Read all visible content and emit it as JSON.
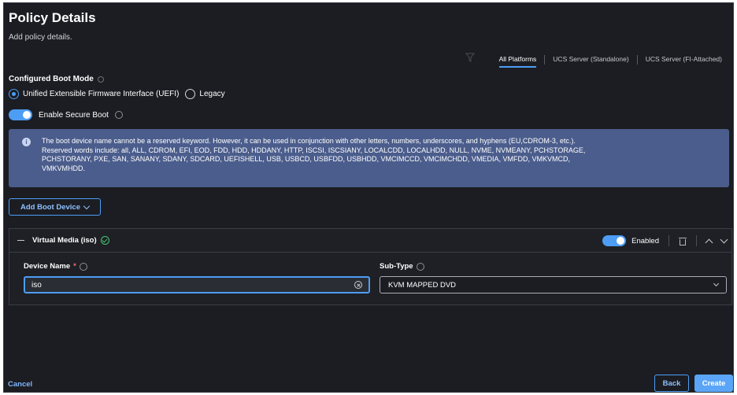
{
  "header": {
    "title": "Policy Details",
    "subtitle": "Add policy details."
  },
  "platform_tabs": [
    {
      "label": "All Platforms",
      "active": true
    },
    {
      "label": "UCS Server (Standalone)",
      "active": false
    },
    {
      "label": "UCS Server (FI-Attached)",
      "active": false
    }
  ],
  "boot_mode": {
    "label": "Configured Boot Mode",
    "options": [
      {
        "label": "Unified Extensible Firmware Interface (UEFI)",
        "checked": true
      },
      {
        "label": "Legacy",
        "checked": false
      }
    ]
  },
  "secure_boot": {
    "label": "Enable Secure Boot",
    "enabled": true
  },
  "info_banner": {
    "text": "The boot device name cannot be a reserved keyword. However, it can be used in conjunction with other letters, numbers, underscores, and hyphens (EU,CDROM-3, etc.). Reserved words include: all, ALL, CDROM, EFI, EOD, FDD, HDD, HDDANY, HTTP, ISCSI, ISCSIANY, LOCALCDD, LOCALHDD, NULL, NVME, NVMEANY, PCHSTORAGE, PCHSTORANY, PXE, SAN, SANANY, SDANY, SDCARD, UEFISHELL, USB, USBCD, USBFDD, USBHDD, VMCIMCCD, VMCIMCHDD, VMEDIA, VMFDD, VMKVMCD, VMKVMHDD."
  },
  "add_boot_device": {
    "label": "Add Boot Device"
  },
  "device_card": {
    "title": "Virtual Media (iso)",
    "enabled_label": "Enabled",
    "device_name": {
      "label": "Device Name",
      "required_mark": "*",
      "value": "iso"
    },
    "sub_type": {
      "label": "Sub-Type",
      "value": "KVM MAPPED DVD"
    }
  },
  "footer": {
    "cancel_label": "Cancel",
    "back_label": "Back",
    "create_label": "Create"
  },
  "colors": {
    "accent": "#4d9df5",
    "background": "#1b1d22",
    "banner": "#4b5d8c",
    "success": "#46c46a"
  }
}
